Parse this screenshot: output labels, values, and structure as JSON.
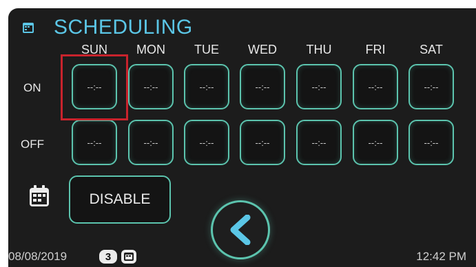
{
  "header": {
    "title": "SCHEDULING",
    "icon": "schedule-icon"
  },
  "days": [
    "SUN",
    "MON",
    "TUE",
    "WED",
    "THU",
    "FRI",
    "SAT"
  ],
  "rows": {
    "on_label": "ON",
    "off_label": "OFF",
    "on_times": [
      "--:--",
      "--:--",
      "--:--",
      "--:--",
      "--:--",
      "--:--",
      "--:--"
    ],
    "off_times": [
      "--:--",
      "--:--",
      "--:--",
      "--:--",
      "--:--",
      "--:--",
      "--:--"
    ]
  },
  "actions": {
    "disable_label": "DISABLE",
    "calendar_icon": "calendar-icon",
    "back_icon": "back-arrow-icon"
  },
  "status": {
    "date": "08/08/2019",
    "badge": "3",
    "time": "12:42 PM"
  },
  "colors": {
    "accent": "#5cc4ae",
    "title": "#5bc6e6",
    "highlight": "#c8232c",
    "background": "#1c1c1c"
  }
}
